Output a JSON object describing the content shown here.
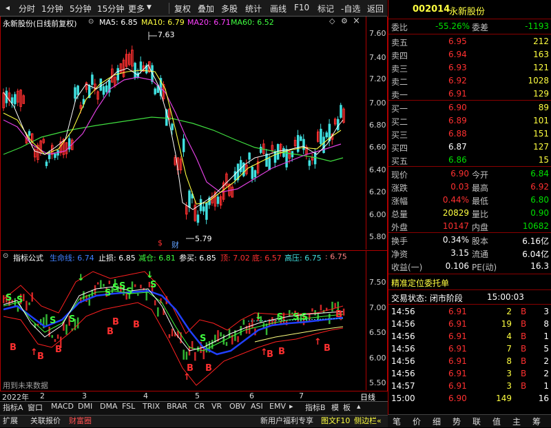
{
  "toolbar": {
    "items": [
      "分时",
      "1分钟",
      "5分钟",
      "15分钟",
      "更多",
      "复权",
      "叠加",
      "多股",
      "统计",
      "画线",
      "F10",
      "标记",
      "-自选",
      "返回"
    ]
  },
  "main_chart": {
    "stock_title": "永新股份(日线前复权)",
    "ma5": "MA5: 6.85",
    "ma10": "MA10: 6.79",
    "ma20": "MA20: 6.71",
    "ma60": "MA60: 6.52",
    "high_mark": "7.63",
    "low_mark": "5.79",
    "fin_mark": "财",
    "dollar_mark": "$",
    "y_labels": [
      "7.60",
      "7.40",
      "7.20",
      "7.00",
      "6.80",
      "6.60",
      "6.40",
      "6.20",
      "6.00",
      "5.80"
    ]
  },
  "indicator": {
    "name": "指标公式",
    "lifeline": "生命线: 6.74",
    "stoploss": "止损: 6.85",
    "reduce": "减仓: 6.81",
    "buyref": "参买: 6.85",
    "top": "顶: 7.02",
    "bottom": "底: 6.57",
    "highpress": "高压: 6.75",
    "highpress2": ": 6.75",
    "y_labels": [
      "7.50",
      "7.00",
      "6.50",
      "6.00",
      "5.50"
    ],
    "note": "用到未来数据",
    "signal_s": "S",
    "signal_b": "B"
  },
  "axis": {
    "year": "2022年",
    "months": [
      "2",
      "3",
      "4",
      "5",
      "6",
      "7"
    ],
    "period": "日线"
  },
  "bottom_tabs": [
    "指标A",
    "窗口",
    "MACD",
    "DMI",
    "DMA",
    "FSL",
    "TRIX",
    "BRAR",
    "CR",
    "VR",
    "OBV",
    "ASI",
    "EMV",
    "指标B",
    "模",
    "板"
  ],
  "bottom_bar": {
    "left": [
      "扩展",
      "关联报价",
      "财富圈"
    ],
    "right": [
      "新用户福利专享",
      "图文F10",
      "侧边栏«"
    ]
  },
  "panel": {
    "code": "002014",
    "name": "永新股份",
    "weibi_label": "委比",
    "weibi": "-55.26%",
    "weicha_label": "委差",
    "weicha": "-1193",
    "asks": [
      {
        "label": "卖五",
        "price": "6.95",
        "vol": "212"
      },
      {
        "label": "卖四",
        "price": "6.94",
        "vol": "163"
      },
      {
        "label": "卖三",
        "price": "6.93",
        "vol": "121"
      },
      {
        "label": "卖二",
        "price": "6.92",
        "vol": "1028"
      },
      {
        "label": "卖一",
        "price": "6.91",
        "vol": "129"
      }
    ],
    "bids": [
      {
        "label": "买一",
        "price": "6.90",
        "vol": "89"
      },
      {
        "label": "买二",
        "price": "6.89",
        "vol": "101"
      },
      {
        "label": "买三",
        "price": "6.88",
        "vol": "151"
      },
      {
        "label": "买四",
        "price": "6.87",
        "vol": "127"
      },
      {
        "label": "买五",
        "price": "6.86",
        "vol": "15"
      }
    ],
    "stats": [
      {
        "l1": "现价",
        "v1": "6.90",
        "l2": "今开",
        "v2": "6.84"
      },
      {
        "l1": "涨跌",
        "v1": "0.03",
        "l2": "最高",
        "v2": "6.92"
      },
      {
        "l1": "涨幅",
        "v1": "0.44%",
        "l2": "最低",
        "v2": "6.80"
      },
      {
        "l1": "总量",
        "v1": "20829",
        "l2": "量比",
        "v2": "0.90"
      },
      {
        "l1": "外盘",
        "v1": "10147",
        "l2": "内盘",
        "v2": "10682"
      }
    ],
    "stats2": [
      {
        "l1": "换手",
        "v1": "0.34%",
        "l2": "股本",
        "v2": "6.16亿"
      },
      {
        "l1": "净资",
        "v1": "3.15",
        "l2": "流通",
        "v2": "6.04亿"
      },
      {
        "l1": "收益(一)",
        "v1": "0.106",
        "l2": "PE(动)",
        "v2": "16.3"
      }
    ],
    "precise_title": "精准定位委托单",
    "trade_status": "交易状态: 闭市阶段",
    "trade_time": "15:00:03",
    "ticks": [
      {
        "t": "14:56",
        "p": "6.91",
        "v": "2",
        "s": "B",
        "n": "3"
      },
      {
        "t": "14:56",
        "p": "6.91",
        "v": "19",
        "s": "B",
        "n": "8"
      },
      {
        "t": "14:56",
        "p": "6.91",
        "v": "4",
        "s": "B",
        "n": "1"
      },
      {
        "t": "14:56",
        "p": "6.91",
        "v": "7",
        "s": "B",
        "n": "5"
      },
      {
        "t": "14:56",
        "p": "6.91",
        "v": "8",
        "s": "B",
        "n": "2"
      },
      {
        "t": "14:56",
        "p": "6.91",
        "v": "3",
        "s": "B",
        "n": "2"
      },
      {
        "t": "14:57",
        "p": "6.91",
        "v": "3",
        "s": "B",
        "n": "1"
      },
      {
        "t": "15:00",
        "p": "6.90",
        "v": "149",
        "s": "",
        "n": "16"
      }
    ],
    "bottom_icons": [
      "笔",
      "价",
      "细",
      "势",
      "联",
      "值",
      "主",
      "筹"
    ]
  }
}
